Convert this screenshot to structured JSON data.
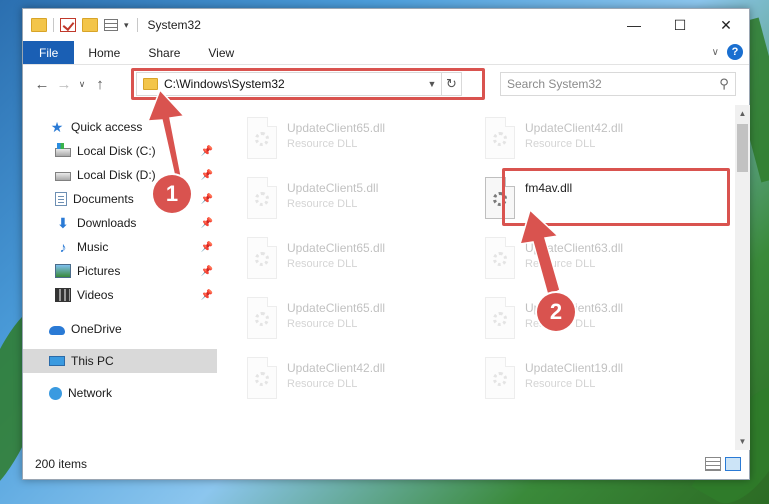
{
  "window": {
    "title": "System32",
    "controls": {
      "minimize": "—",
      "maximize": "☐",
      "close": "✕"
    }
  },
  "ribbon": {
    "tabs": [
      "File",
      "Home",
      "Share",
      "View"
    ],
    "help": "?"
  },
  "nav": {
    "address": "C:\\Windows\\System32",
    "search_placeholder": "Search System32"
  },
  "sidebar": {
    "items": [
      {
        "label": "Quick access",
        "icon": "star-icon"
      },
      {
        "label": "Local Disk (C:)",
        "icon": "drive-icon",
        "pinned": true
      },
      {
        "label": "Local Disk (D:)",
        "icon": "drive-icon",
        "pinned": true
      },
      {
        "label": "Documents",
        "icon": "documents-icon",
        "pinned": true
      },
      {
        "label": "Downloads",
        "icon": "download-icon",
        "pinned": true
      },
      {
        "label": "Music",
        "icon": "music-icon",
        "pinned": true
      },
      {
        "label": "Pictures",
        "icon": "pictures-icon",
        "pinned": true
      },
      {
        "label": "Videos",
        "icon": "videos-icon",
        "pinned": true
      },
      {
        "label": "OneDrive",
        "icon": "cloud-icon"
      },
      {
        "label": "This PC",
        "icon": "computer-icon",
        "selected": true
      },
      {
        "label": "Network",
        "icon": "network-icon"
      }
    ]
  },
  "files": [
    {
      "name": "UpdateClient65.dll",
      "type": "Resource DLL",
      "faded": true
    },
    {
      "name": "UpdateClient42.dll",
      "type": "Resource DLL",
      "faded": true
    },
    {
      "name": "UpdateClient5.dll",
      "type": "Resource DLL",
      "faded": true
    },
    {
      "name": "fm4av.dll",
      "type": "",
      "faded": false,
      "highlighted": true
    },
    {
      "name": "UpdateClient65.dll",
      "type": "Resource DLL",
      "faded": true
    },
    {
      "name": "UpdateClient63.dll",
      "type": "Resource DLL",
      "faded": true
    },
    {
      "name": "UpdateClient65.dll",
      "type": "Resource DLL",
      "faded": true
    },
    {
      "name": "UpdateClient63.dll",
      "type": "Resource DLL",
      "faded": true
    },
    {
      "name": "UpdateClient42.dll",
      "type": "Resource DLL",
      "faded": true
    },
    {
      "name": "UpdateClient19.dll",
      "type": "Resource DLL",
      "faded": true
    }
  ],
  "status": {
    "item_count": "200 items"
  },
  "annotations": {
    "step1": "1",
    "step2": "2",
    "color": "#d9534f"
  }
}
